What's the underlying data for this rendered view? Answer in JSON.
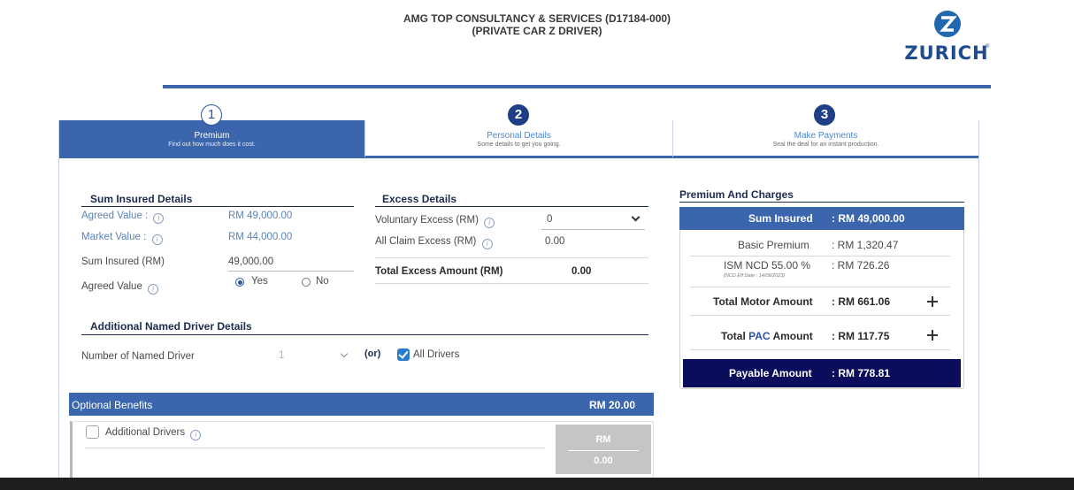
{
  "header": {
    "title_line1": "AMG TOP CONSULTANCY & SERVICES (D17184-000)",
    "title_line2": "(PRIVATE CAR Z DRIVER)",
    "logo_text": "ZURICH",
    "logo_mark": "Z",
    "logo_reg": "®"
  },
  "steps": [
    {
      "num": "1",
      "label": "Premium",
      "sub": "Find out how much does it cost."
    },
    {
      "num": "2",
      "label": "Personal Details",
      "sub": "Some details to get you going."
    },
    {
      "num": "3",
      "label": "Make Payments",
      "sub": "Seal the deal for an instant production."
    }
  ],
  "sum_insured": {
    "title": "Sum Insured Details",
    "agreed_value_label": "Agreed Value :",
    "agreed_value": "RM  49,000.00",
    "market_value_label": "Market Value :",
    "market_value": "RM  44,000.00",
    "sum_insured_label": "Sum Insured (RM)",
    "sum_insured_value": "49,000.00",
    "agreed_value_q_label": "Agreed Value",
    "yes_label": "Yes",
    "no_label": "No"
  },
  "excess": {
    "title": "Excess Details",
    "voluntary_label": "Voluntary Excess (RM)",
    "voluntary_value": "0",
    "all_claim_label": "All Claim Excess (RM)",
    "all_claim_value": "0.00",
    "total_label": "Total Excess Amount (RM)",
    "total_value": "0.00"
  },
  "named_driver": {
    "title": "Additional Named Driver Details",
    "number_label": "Number of Named Driver",
    "number_value": "1",
    "or_label": "(or)",
    "all_drivers_label": "All Drivers"
  },
  "optional_benefits": {
    "title": "Optional Benefits",
    "total": "RM 20.00",
    "additional_drivers_label": "Additional Drivers",
    "rm_label": "RM",
    "rm_value": "0.00"
  },
  "premium_charges": {
    "title": "Premium And Charges",
    "sum_insured_label": "Sum Insured",
    "sum_insured_value": ":  RM 49,000.00",
    "basic_premium_label": "Basic Premium",
    "basic_premium_value": ":  RM 1,320.47",
    "ncd_label": "ISM NCD 55.00 %",
    "ncd_value": ":  RM 726.26",
    "ncd_date": "(NCD Eff Date : 14/09/2023)",
    "total_motor_label": "Total Motor Amount",
    "total_motor_value": ":  RM 661.06",
    "total_pac_prefix": "Total ",
    "total_pac_highlight": "PAC",
    "total_pac_suffix": " Amount",
    "total_pac_value": ":  RM 117.75",
    "payable_label": "Payable Amount",
    "payable_value": ":  RM 778.81"
  },
  "info_glyph": "i",
  "colors": {
    "primary": "#3b66ad",
    "navy": "#0a0d5c",
    "link": "#4a86cf"
  }
}
